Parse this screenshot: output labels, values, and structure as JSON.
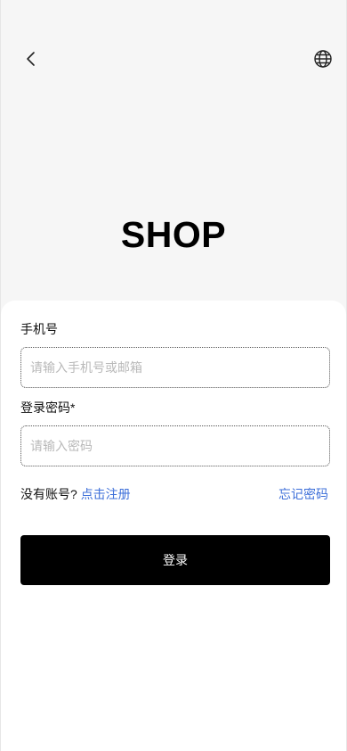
{
  "header": {
    "back_icon": "chevron-left-icon",
    "language_icon": "globe-icon"
  },
  "brand": {
    "name": "SHOP"
  },
  "form": {
    "phone_label": "手机号",
    "phone_placeholder": "请输入手机号或邮箱",
    "phone_value": "",
    "password_label": "登录密码*",
    "password_placeholder": "请输入密码",
    "password_value": ""
  },
  "links": {
    "no_account_text": "没有账号?",
    "register_link": "点击注册",
    "forgot_password_link": "忘记密码"
  },
  "actions": {
    "login_label": "登录"
  },
  "colors": {
    "link": "#3d6fd9",
    "primary_button": "#000000",
    "background": "#f6f6f6"
  }
}
